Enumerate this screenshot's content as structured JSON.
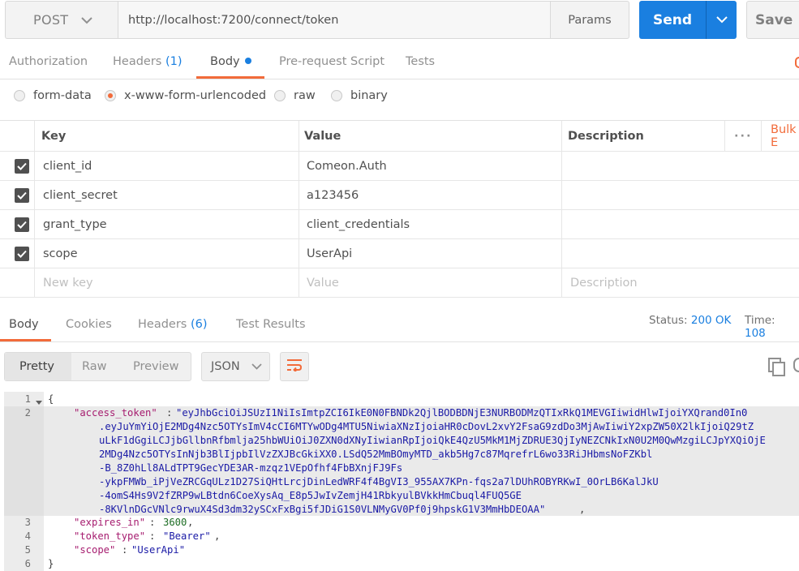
{
  "request": {
    "method": "POST",
    "url": "http://localhost:7200/connect/token",
    "params_label": "Params",
    "send_label": "Send",
    "save_label": "Save"
  },
  "request_tabs": [
    {
      "label": "Authorization",
      "count": ""
    },
    {
      "label": "Headers",
      "count": "(1)"
    },
    {
      "label": "Body",
      "count": ""
    },
    {
      "label": "Pre-request Script",
      "count": ""
    },
    {
      "label": "Tests",
      "count": ""
    }
  ],
  "body_types": [
    {
      "label": "form-data",
      "selected": false
    },
    {
      "label": "x-www-form-urlencoded",
      "selected": true
    },
    {
      "label": "raw",
      "selected": false
    },
    {
      "label": "binary",
      "selected": false
    }
  ],
  "kv_table": {
    "headers": {
      "key": "Key",
      "value": "Value",
      "description": "Description",
      "bulk": "Bulk E"
    },
    "rows": [
      {
        "key": "client_id",
        "value": "Comeon.Auth"
      },
      {
        "key": "client_secret",
        "value": "a123456"
      },
      {
        "key": "grant_type",
        "value": "client_credentials"
      },
      {
        "key": "scope",
        "value": "UserApi"
      }
    ],
    "placeholder": {
      "key": "New key",
      "value": "Value",
      "description": "Description"
    }
  },
  "response_tabs": [
    {
      "label": "Body",
      "count": ""
    },
    {
      "label": "Cookies",
      "count": ""
    },
    {
      "label": "Headers",
      "count": "(6)"
    },
    {
      "label": "Test Results",
      "count": ""
    }
  ],
  "status": {
    "label": "Status:",
    "value": "200 OK",
    "time_label": "Time:",
    "time_value": "108"
  },
  "view": {
    "modes": [
      "Pretty",
      "Raw",
      "Preview"
    ],
    "format": "JSON"
  },
  "code": {
    "line_numbers": [
      "1",
      "2",
      "3",
      "4",
      "5",
      "6"
    ],
    "open": "{",
    "close": "}",
    "access_token_key": "\"access_token\"",
    "access_token_lines": [
      "\"eyJhbGciOiJSUzI1NiIsImtpZCI6IkE0N0FBNDk2QjlBODBDNjE3NURBODMzQTIxRkQ1MEVGIiwidHlwIjoiYXQrand0In0",
      ".eyJuYmYiOjE2MDg4Nzc5OTYsImV4cCI6MTYwODg4MTU5NiwiaXNzIjoiaHR0cDovL2xvY2FsaG9zdDo3MjAwIiwiY2xpZW50X2lkIjoiQ29tZ",
      "uLkF1dGgiLCJjbGllbnRfbmlja25hbWUiOiJ0ZXN0dXNyIiwianRpIjoiQkE4QzU5MkM1MjZDRUE3QjIyNEZCNkIxN0U2M0QwMzgiLCJpYXQiOjE",
      "2MDg4Nzc5OTYsInNjb3BlIjpbIlVzZXJBcGkiXX0.LSdQ52MmBOmyMTD_akb5Hg7c87MqrefrL6wo33RiJHbmsNoFZKbl",
      "-B_8Z0hLl8ALdTPT9GecYDE3AR-mzqz1VEpOfhf4FbBXnjFJ9Fs",
      "-ykpFMWb_iPjVeZRCGqULz1D27SiQHtLrcjDinLedWRF4f4BgVI3_955AX7KPn-fqs2a7lDUhROBYRKwI_0OrLB6KalJkU",
      "-4omS4Hs9V2fZRP9wLBtdn6CoeXysAq_E8p5JwIvZemjH41RbkyulBVkkHmCbuql4FUQ5GE",
      "-8KVlnDGcVNlc9rwuX4Sd3dm32ySCxFxBgi5fJDiG1S0VLNMyGV0Pf0j9hpskG1V3MmHbDEOAA\""
    ],
    "expires_in_key": "\"expires_in\"",
    "expires_in": "3600",
    "token_type_key": "\"token_type\"",
    "token_type": "\"Bearer\"",
    "scope_key": "\"scope\"",
    "scope": "\"UserApi\""
  },
  "colors": {
    "accent": "#1a7fe0",
    "tab_underline": "#f26b3a",
    "key": "#a61c6f",
    "string": "#1a1aa6",
    "number": "#1d6d24"
  }
}
